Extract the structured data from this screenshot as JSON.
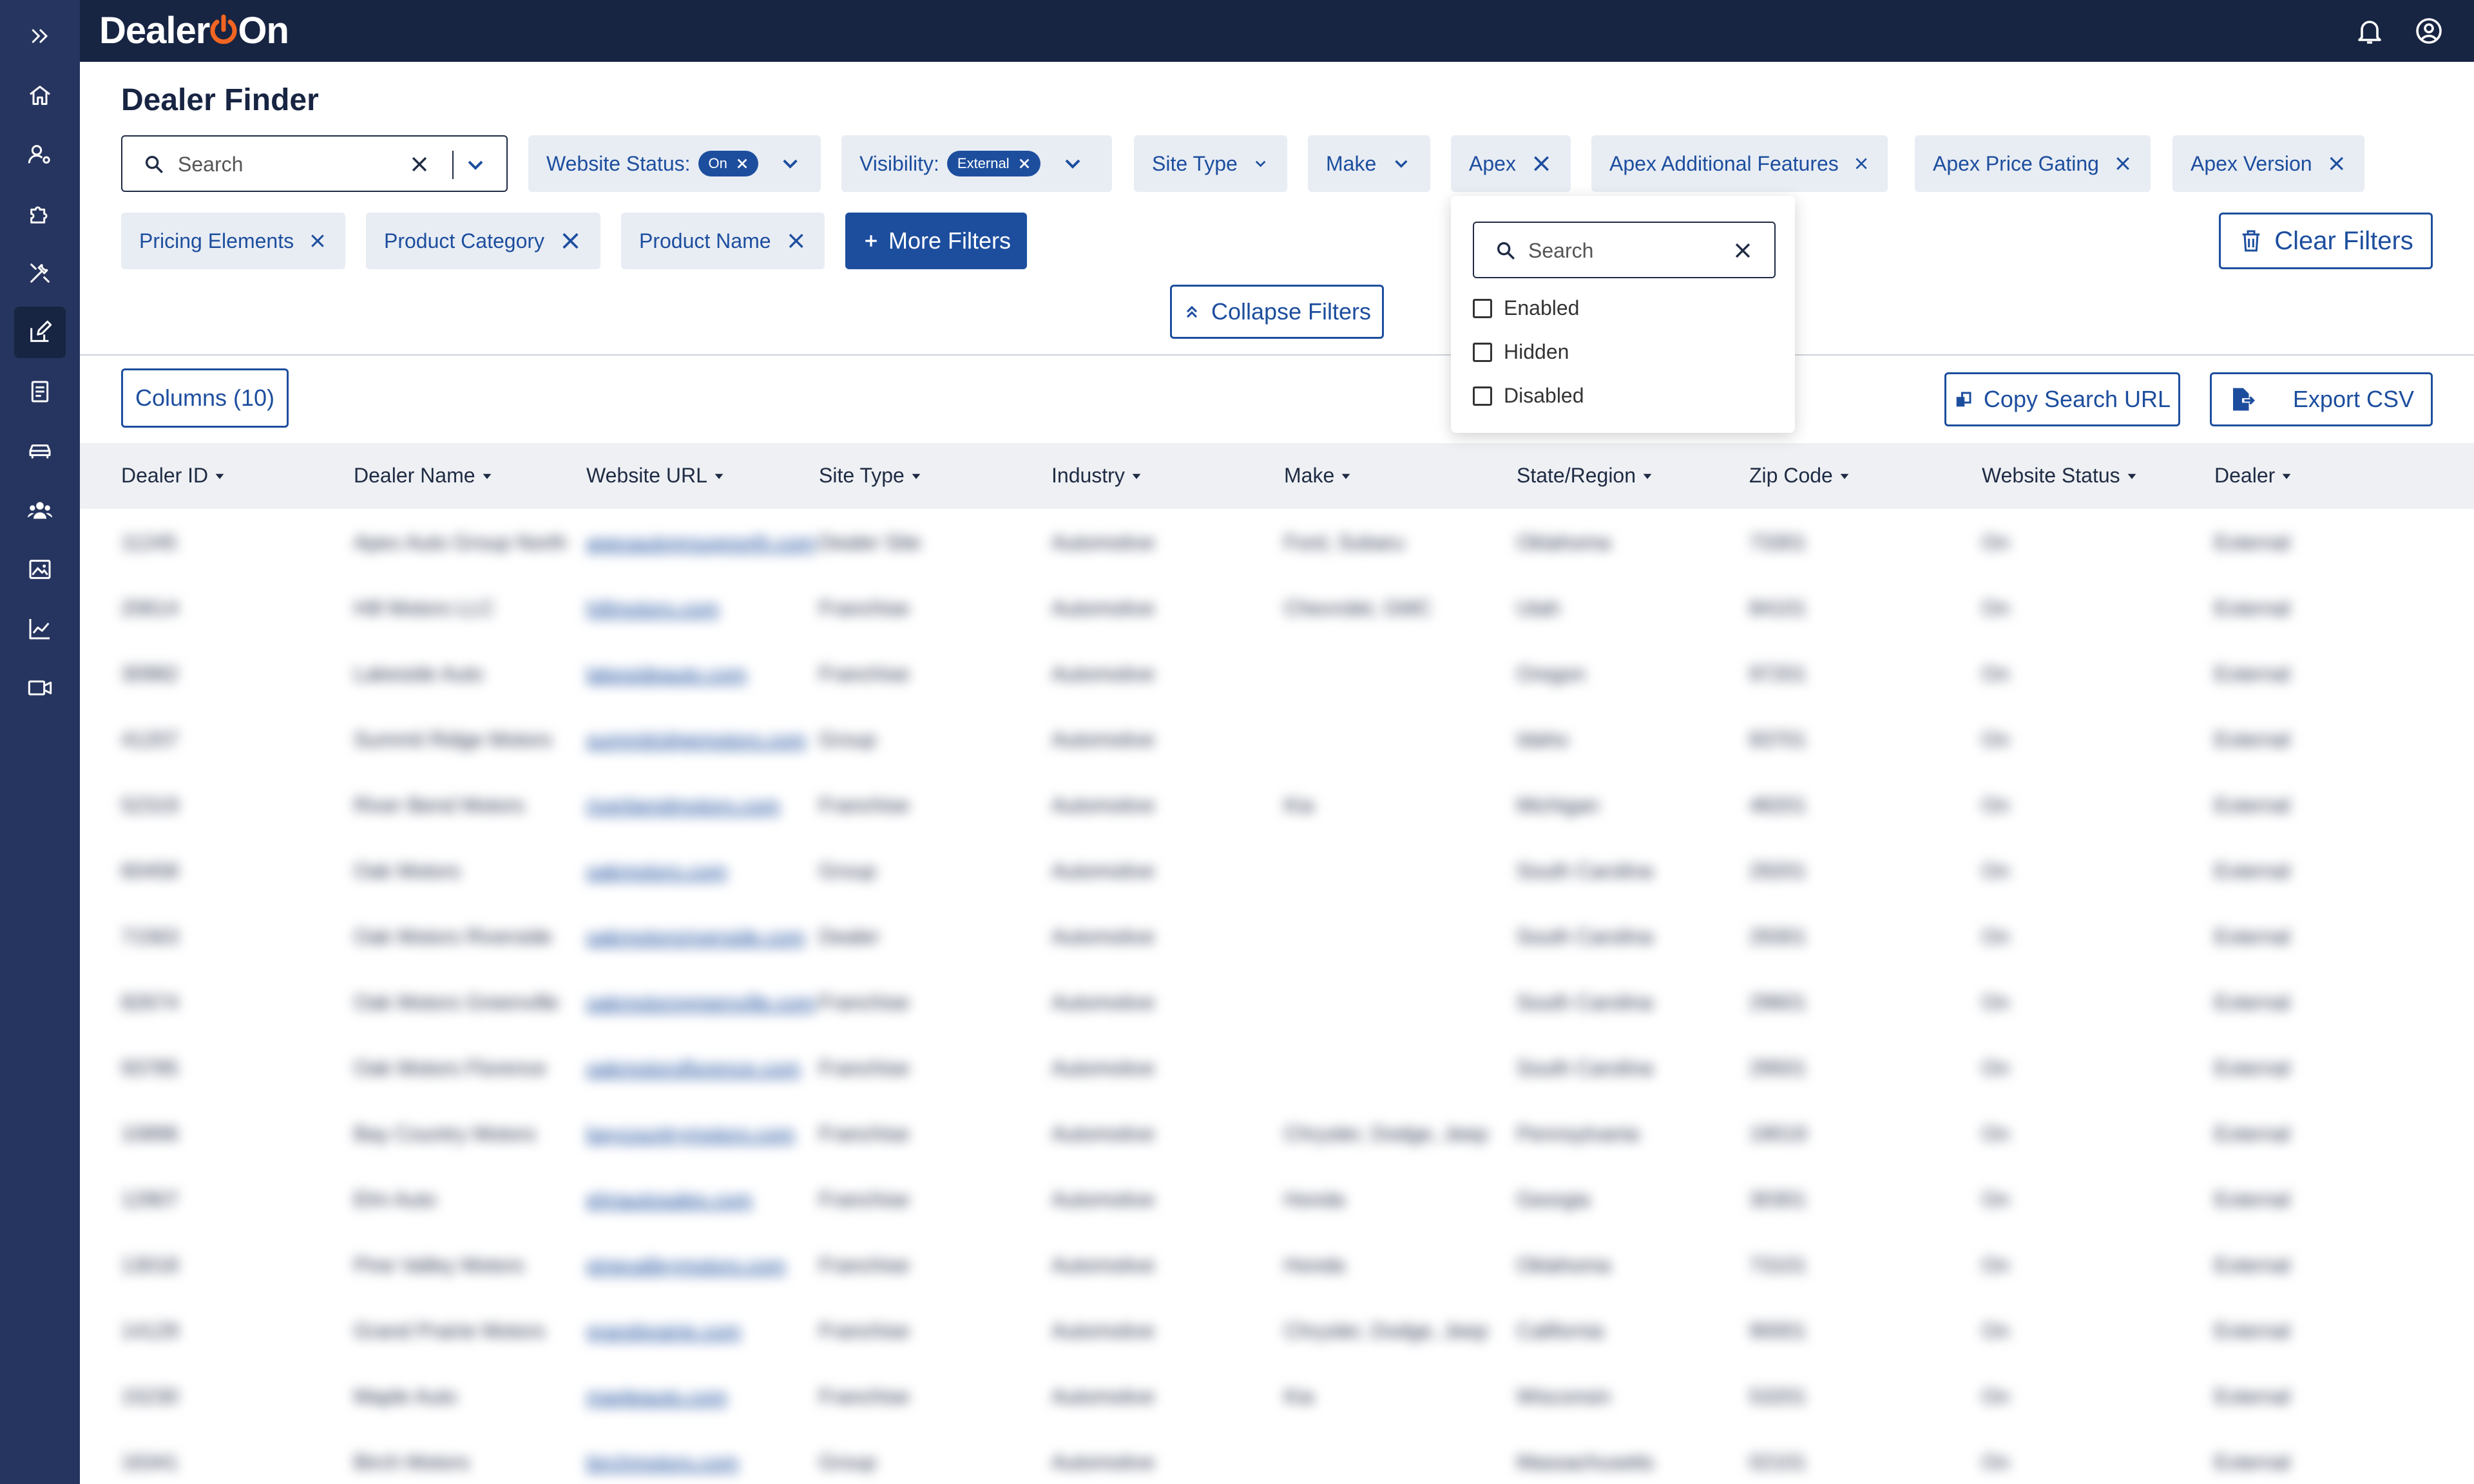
{
  "app": {
    "logo_text": "Dealer",
    "logo_on_text": "On"
  },
  "sidebar": {
    "items": [
      {
        "icon": "expand-icon"
      },
      {
        "icon": "home-icon"
      },
      {
        "icon": "user-settings-icon"
      },
      {
        "icon": "puzzle-icon"
      },
      {
        "icon": "tools-icon"
      },
      {
        "icon": "edit-icon",
        "active": true
      },
      {
        "icon": "document-icon"
      },
      {
        "icon": "car-icon"
      },
      {
        "icon": "users-icon"
      },
      {
        "icon": "image-icon"
      },
      {
        "icon": "chart-icon"
      },
      {
        "icon": "video-icon"
      }
    ]
  },
  "header": {
    "title": "Dealer Finder"
  },
  "search": {
    "placeholder": "Search"
  },
  "filters": {
    "website_status": {
      "label": "Website Status:",
      "value": "On"
    },
    "visibility": {
      "label": "Visibility:",
      "value": "External"
    },
    "site_type": "Site Type",
    "make": "Make",
    "apex": "Apex",
    "apex_additional_features": "Apex Additional Features",
    "apex_price_gating": "Apex Price Gating",
    "apex_version": "Apex Version",
    "pricing_elements": "Pricing Elements",
    "product_category": "Product Category",
    "product_name": "Product Name",
    "more_filters": "More Filters",
    "clear_filters": "Clear Filters",
    "collapse_filters": "Collapse Filters"
  },
  "toolbar": {
    "columns": "Columns (10)",
    "copy_url": "Copy Search URL",
    "export_csv": "Export CSV"
  },
  "dropdown": {
    "search_placeholder": "Search",
    "options": [
      "Enabled",
      "Hidden",
      "Disabled"
    ]
  },
  "table": {
    "columns": [
      "Dealer ID",
      "Dealer Name",
      "Website URL",
      "Site Type",
      "Industry",
      "Make",
      "State/Region",
      "Zip Code",
      "Website Status",
      "Dealer"
    ],
    "rows": [
      [
        "11245",
        "Apex Auto Group North",
        "apexautogroupnorth.com",
        "Dealer Site",
        "Automotive",
        "Ford, Subaru",
        "Oklahoma",
        "73301",
        "On",
        "External"
      ],
      [
        "20614",
        "Hill Motors LLC",
        "hillmotors.com",
        "Franchise",
        "Automotive",
        "Chevrolet, GMC",
        "Utah",
        "84101",
        "On",
        "External"
      ],
      [
        "30982",
        "Lakeside Auto",
        "lakesideauto.com",
        "Franchise",
        "Automotive",
        "",
        "Oregon",
        "97201",
        "On",
        "External"
      ],
      [
        "41207",
        "Summit Ridge Motors",
        "summitridgemotors.com",
        "Group",
        "Automotive",
        "",
        "Idaho",
        "83701",
        "On",
        "External"
      ],
      [
        "52319",
        "River Bend Motors",
        "riverbendmotors.com",
        "Franchise",
        "Automotive",
        "Kia",
        "Michigan",
        "48201",
        "On",
        "External"
      ],
      [
        "60458",
        "Oak Motors",
        "oakmotors.com",
        "Group",
        "Automotive",
        "",
        "South Carolina",
        "29201",
        "On",
        "External"
      ],
      [
        "71563",
        "Oak Motors Riverside",
        "oakmotorsriverside.com",
        "Dealer",
        "Automotive",
        "",
        "South Carolina",
        "29301",
        "On",
        "External"
      ],
      [
        "82674",
        "Oak Motors Greenville",
        "oakmotorsgreenville.com",
        "Franchise",
        "Automotive",
        "",
        "South Carolina",
        "29601",
        "On",
        "External"
      ],
      [
        "93785",
        "Oak Motors Florence",
        "oakmotorsflorence.com",
        "Franchise",
        "Automotive",
        "",
        "South Carolina",
        "29501",
        "On",
        "External"
      ],
      [
        "10896",
        "Bay Country Motors",
        "baycountrymotors.com",
        "Franchise",
        "Automotive",
        "Chrysler, Dodge, Jeep",
        "Pennsylvania",
        "19019",
        "On",
        "External"
      ],
      [
        "12907",
        "Elm Auto",
        "elmautosales.com",
        "Franchise",
        "Automotive",
        "Honda",
        "Georgia",
        "30301",
        "On",
        "External"
      ],
      [
        "13018",
        "Pine Valley Motors",
        "pinevalleymotors.com",
        "Franchise",
        "Automotive",
        "Honda",
        "Oklahoma",
        "73101",
        "On",
        "External"
      ],
      [
        "14129",
        "Grand Prairie Motors",
        "grandprairie.com",
        "Franchise",
        "Automotive",
        "Chrysler, Dodge, Jeep",
        "California",
        "90001",
        "On",
        "External"
      ],
      [
        "15230",
        "Maple Auto",
        "mapleauto.com",
        "Franchise",
        "Automotive",
        "Kia",
        "Wisconsin",
        "53201",
        "On",
        "External"
      ],
      [
        "16341",
        "Birch Motors",
        "birchmotors.com",
        "Group",
        "Automotive",
        "",
        "Massachusetts",
        "02101",
        "On",
        "External"
      ]
    ]
  },
  "colors": {
    "navy": "#172442",
    "sidebar": "#26355f",
    "accent": "#1d4e9e",
    "brand_orange": "#f26522",
    "chip_bg": "#e8edf4"
  }
}
